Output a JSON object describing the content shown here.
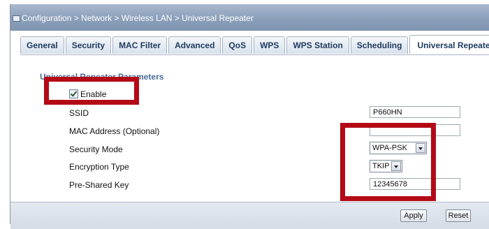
{
  "breadcrumb": "Configuration > Network > Wireless LAN > Universal Repeater",
  "tabs": [
    {
      "label": "General"
    },
    {
      "label": "Security"
    },
    {
      "label": "MAC Filter"
    },
    {
      "label": "Advanced"
    },
    {
      "label": "QoS"
    },
    {
      "label": "WPS"
    },
    {
      "label": "WPS Station"
    },
    {
      "label": "Scheduling"
    },
    {
      "label": "Universal Repeater"
    }
  ],
  "active_tab": "Universal Repeater",
  "section": {
    "title": "Universal Repeater Parameters"
  },
  "enable": {
    "label": "Enable",
    "checked": true
  },
  "fields": {
    "ssid": {
      "label": "SSID",
      "value": "P660HN"
    },
    "mac": {
      "label": "MAC Address (Optional)",
      "value": ""
    },
    "security_mode": {
      "label": "Security Mode",
      "value": "WPA-PSK"
    },
    "encryption_type": {
      "label": "Encryption Type",
      "value": "TKIP"
    },
    "psk": {
      "label": "Pre-Shared Key",
      "value": "12345678"
    }
  },
  "buttons": {
    "apply": "Apply",
    "reset": "Reset"
  },
  "colors": {
    "highlight": "#b30a16",
    "title_bar": "#8b9fba",
    "accent_text": "#4b6b9a"
  }
}
